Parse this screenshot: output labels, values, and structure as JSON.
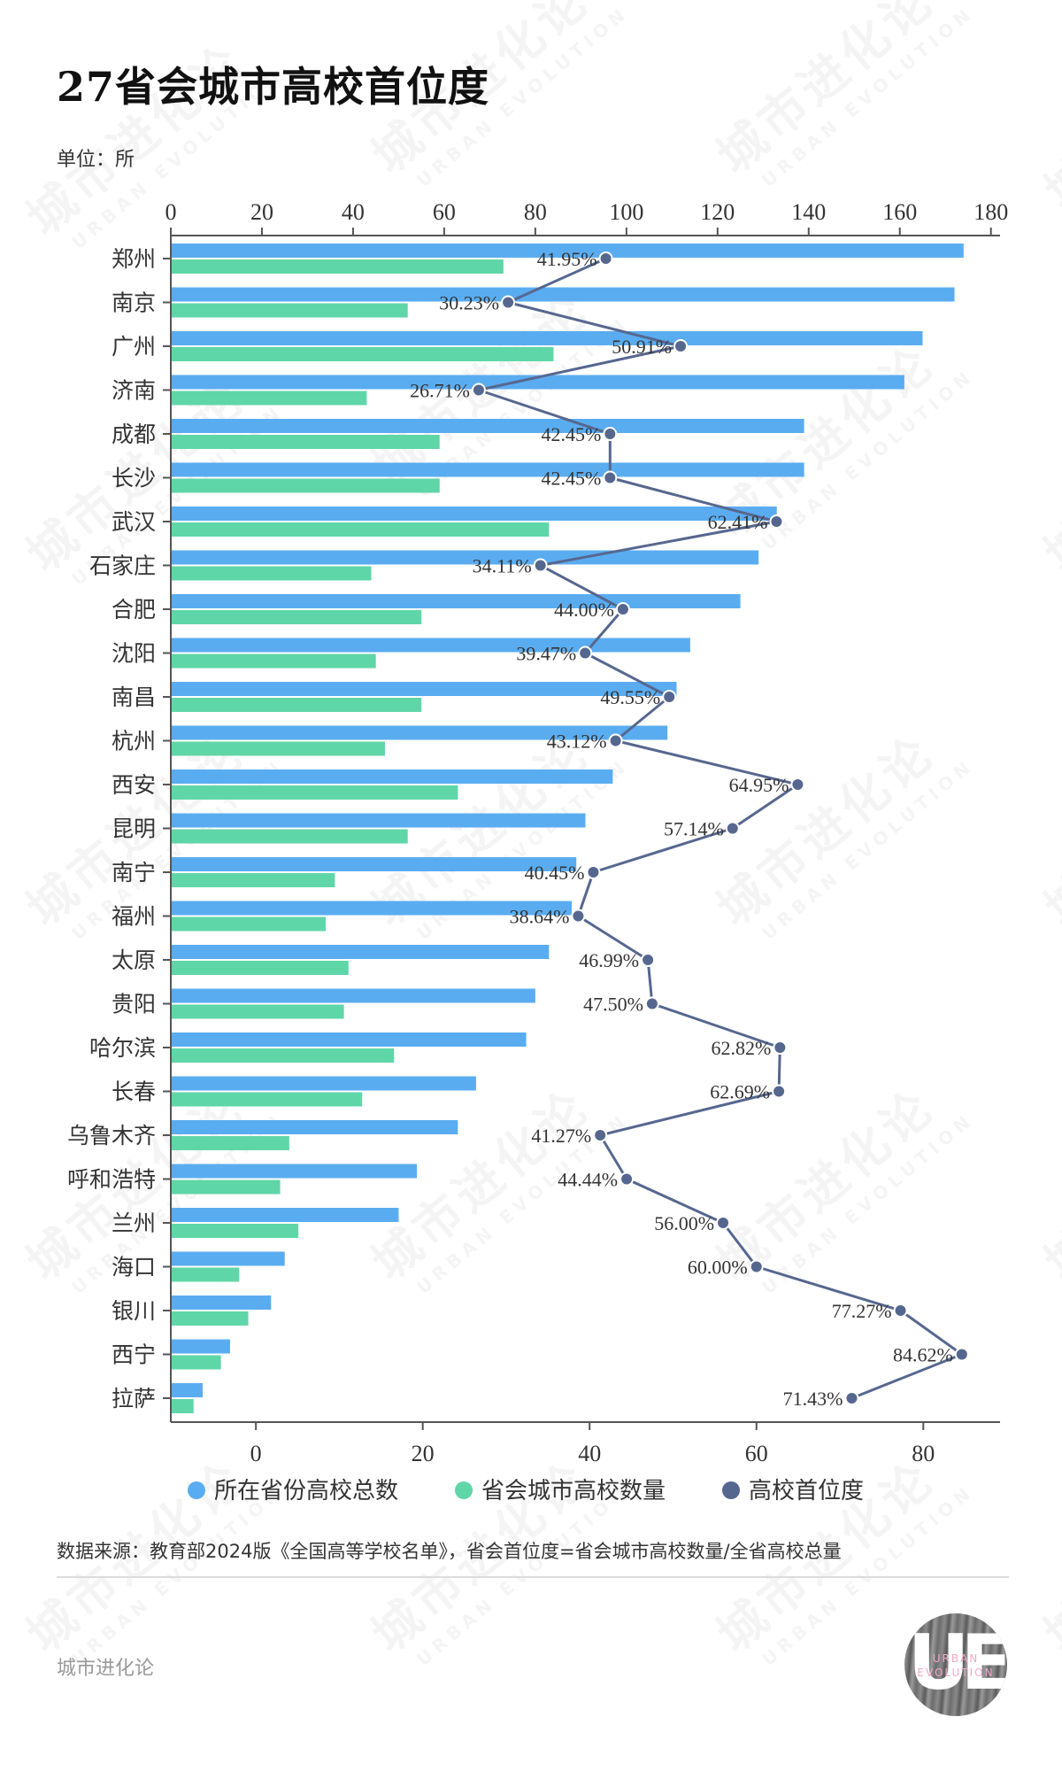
{
  "title": "27省会城市高校首位度",
  "unit": "单位：所",
  "source": "数据来源：教育部2024版《全国高等学校名单》，省会首位度=省会城市高校数量/全省高校总量",
  "brand": "城市进化论",
  "watermark": {
    "cn": "城市进化论",
    "en": "URBAN EVOLUTION"
  },
  "logo": {
    "mark": "UE",
    "line1": "URBAN",
    "line2": "EVOLUTION"
  },
  "colors": {
    "province_total": "#5aacf0",
    "capital_count": "#5fd6a8",
    "primacy": "#56678f"
  },
  "chart_data": {
    "type": "bar",
    "title": "27省会城市高校首位度",
    "subtitle": "单位：所",
    "orientation": "horizontal",
    "categories": [
      "郑州",
      "南京",
      "广州",
      "济南",
      "成都",
      "长沙",
      "武汉",
      "石家庄",
      "合肥",
      "沈阳",
      "南昌",
      "杭州",
      "西安",
      "昆明",
      "南宁",
      "福州",
      "太原",
      "贵阳",
      "哈尔滨",
      "长春",
      "乌鲁木齐",
      "呼和浩特",
      "兰州",
      "海口",
      "银川",
      "西宁",
      "拉萨"
    ],
    "series": [
      {
        "name": "所在省份高校总数",
        "type": "bar",
        "axis": "top",
        "values": [
          174,
          172,
          165,
          161,
          139,
          139,
          133,
          129,
          125,
          114,
          111,
          109,
          97,
          91,
          89,
          88,
          83,
          80,
          78,
          67,
          63,
          54,
          50,
          25,
          22,
          13,
          7
        ]
      },
      {
        "name": "省会城市高校数量",
        "type": "bar",
        "axis": "top",
        "values": [
          73,
          52,
          84,
          43,
          59,
          59,
          83,
          44,
          55,
          45,
          55,
          47,
          63,
          52,
          36,
          34,
          39,
          38,
          49,
          42,
          26,
          24,
          28,
          15,
          17,
          11,
          5
        ]
      },
      {
        "name": "高校首位度",
        "type": "line",
        "axis": "bottom",
        "unit": "%",
        "values": [
          41.95,
          30.23,
          50.91,
          26.71,
          42.45,
          42.45,
          62.41,
          34.11,
          44.0,
          39.47,
          49.55,
          43.12,
          64.95,
          57.14,
          40.45,
          38.64,
          46.99,
          47.5,
          62.82,
          62.69,
          41.27,
          44.44,
          56.0,
          60.0,
          77.27,
          84.62,
          71.43
        ],
        "labels": [
          "41.95%",
          "30.23%",
          "50.91%",
          "26.71%",
          "42.45%",
          "42.45%",
          "62.41%",
          "34.11%",
          "44.00%",
          "39.47%",
          "49.55%",
          "43.12%",
          "64.95%",
          "57.14%",
          "40.45%",
          "38.64%",
          "46.99%",
          "47.50%",
          "62.82%",
          "62.69%",
          "41.27%",
          "44.44%",
          "56.00%",
          "60.00%",
          "77.27%",
          "84.62%",
          "71.43%"
        ]
      }
    ],
    "top_axis": {
      "range": [
        0,
        182
      ],
      "ticks": [
        0,
        20,
        40,
        60,
        80,
        100,
        120,
        140,
        160,
        180
      ]
    },
    "bottom_axis": {
      "range": [
        -10.2,
        89.2
      ],
      "ticks": [
        0,
        20,
        40,
        60,
        80
      ]
    },
    "legend": {
      "position": "bottom",
      "items": [
        "所在省份高校总数",
        "省会城市高校数量",
        "高校首位度"
      ]
    },
    "grid": false
  }
}
